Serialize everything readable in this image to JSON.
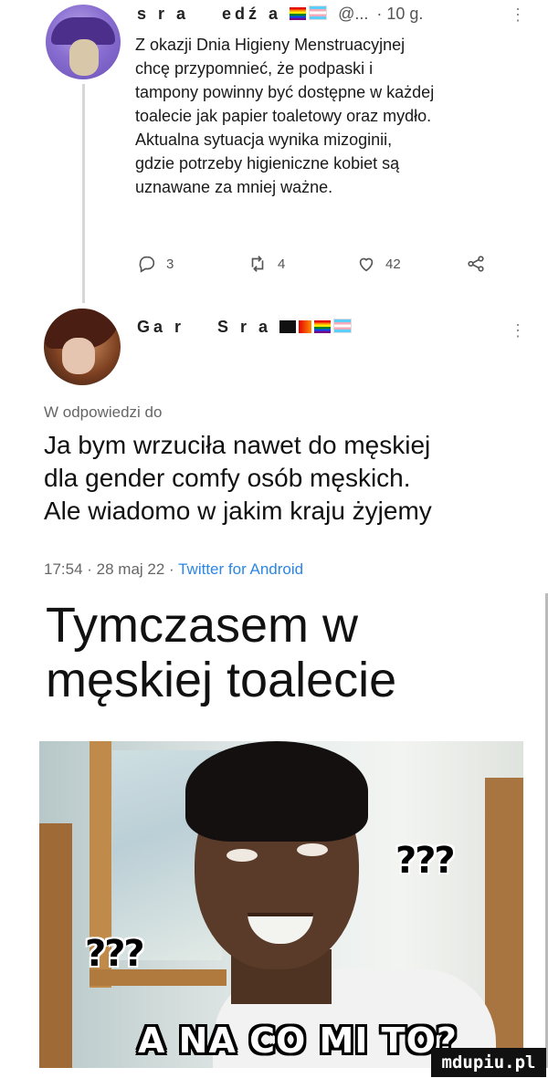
{
  "tweet1": {
    "name": "s r a",
    "name2": "edź a",
    "handle": "@...",
    "time": "· 10 g.",
    "more": "⋮",
    "text": "Z okazji Dnia Higieny Menstruacyjnej\nchcę przypomnieć, że podpaski i\ntampony powinny być dostępne w każdej\ntoalecie jak papier toaletowy oraz mydło.\nAktualna sytuacja wynika mizoginii,\ngdzie potrzeby higieniczne kobiet są\nuznawane za mniej ważne.",
    "replies": "3",
    "retweets": "4",
    "likes": "42",
    "icons": [
      "reply-icon",
      "retweet-icon",
      "like-icon",
      "share-icon"
    ]
  },
  "tweet2": {
    "name": "Ga r",
    "name2": "S r a",
    "more": "⋮",
    "reply_to": "W odpowiedzi do",
    "text": "Ja bym wrzuciła nawet do męskiej\ndla gender comfy osób męskich.\nAle wiadomo w jakim kraju żyjemy",
    "meta": "17:54 · 28 maj 22 · ",
    "app": "Twitter for Android"
  },
  "caption": "Tymczasem w\nmęskiej toalecie",
  "meme": {
    "q1": "???",
    "q2": "???",
    "bottom": "A NA CO MI TO?"
  },
  "watermark": "mdupiu.pl",
  "colors": {
    "link": "#2b86e6",
    "muted": "#666666"
  }
}
